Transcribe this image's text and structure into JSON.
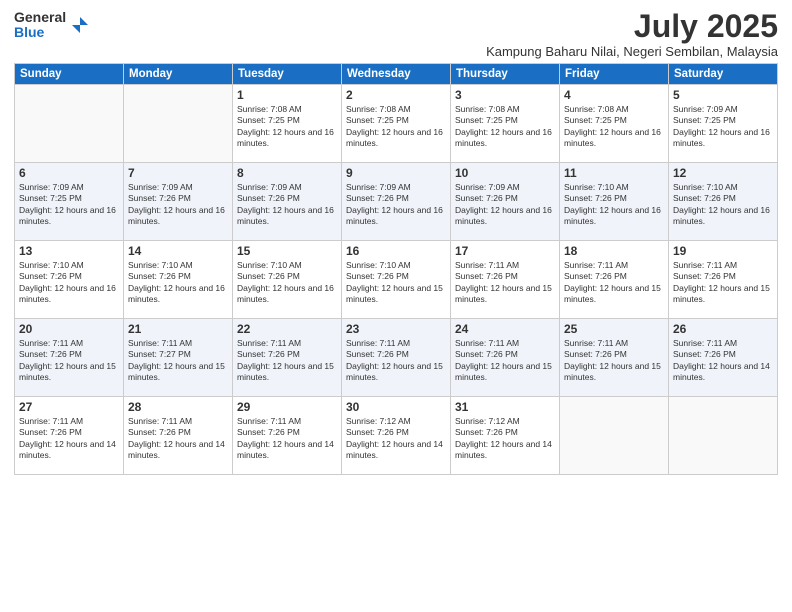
{
  "logo": {
    "general": "General",
    "blue": "Blue"
  },
  "title": "July 2025",
  "subtitle": "Kampung Baharu Nilai, Negeri Sembilan, Malaysia",
  "days_of_week": [
    "Sunday",
    "Monday",
    "Tuesday",
    "Wednesday",
    "Thursday",
    "Friday",
    "Saturday"
  ],
  "weeks": [
    [
      {
        "day": "",
        "sunrise": "",
        "sunset": "",
        "daylight": ""
      },
      {
        "day": "",
        "sunrise": "",
        "sunset": "",
        "daylight": ""
      },
      {
        "day": "1",
        "sunrise": "Sunrise: 7:08 AM",
        "sunset": "Sunset: 7:25 PM",
        "daylight": "Daylight: 12 hours and 16 minutes."
      },
      {
        "day": "2",
        "sunrise": "Sunrise: 7:08 AM",
        "sunset": "Sunset: 7:25 PM",
        "daylight": "Daylight: 12 hours and 16 minutes."
      },
      {
        "day": "3",
        "sunrise": "Sunrise: 7:08 AM",
        "sunset": "Sunset: 7:25 PM",
        "daylight": "Daylight: 12 hours and 16 minutes."
      },
      {
        "day": "4",
        "sunrise": "Sunrise: 7:08 AM",
        "sunset": "Sunset: 7:25 PM",
        "daylight": "Daylight: 12 hours and 16 minutes."
      },
      {
        "day": "5",
        "sunrise": "Sunrise: 7:09 AM",
        "sunset": "Sunset: 7:25 PM",
        "daylight": "Daylight: 12 hours and 16 minutes."
      }
    ],
    [
      {
        "day": "6",
        "sunrise": "Sunrise: 7:09 AM",
        "sunset": "Sunset: 7:25 PM",
        "daylight": "Daylight: 12 hours and 16 minutes."
      },
      {
        "day": "7",
        "sunrise": "Sunrise: 7:09 AM",
        "sunset": "Sunset: 7:26 PM",
        "daylight": "Daylight: 12 hours and 16 minutes."
      },
      {
        "day": "8",
        "sunrise": "Sunrise: 7:09 AM",
        "sunset": "Sunset: 7:26 PM",
        "daylight": "Daylight: 12 hours and 16 minutes."
      },
      {
        "day": "9",
        "sunrise": "Sunrise: 7:09 AM",
        "sunset": "Sunset: 7:26 PM",
        "daylight": "Daylight: 12 hours and 16 minutes."
      },
      {
        "day": "10",
        "sunrise": "Sunrise: 7:09 AM",
        "sunset": "Sunset: 7:26 PM",
        "daylight": "Daylight: 12 hours and 16 minutes."
      },
      {
        "day": "11",
        "sunrise": "Sunrise: 7:10 AM",
        "sunset": "Sunset: 7:26 PM",
        "daylight": "Daylight: 12 hours and 16 minutes."
      },
      {
        "day": "12",
        "sunrise": "Sunrise: 7:10 AM",
        "sunset": "Sunset: 7:26 PM",
        "daylight": "Daylight: 12 hours and 16 minutes."
      }
    ],
    [
      {
        "day": "13",
        "sunrise": "Sunrise: 7:10 AM",
        "sunset": "Sunset: 7:26 PM",
        "daylight": "Daylight: 12 hours and 16 minutes."
      },
      {
        "day": "14",
        "sunrise": "Sunrise: 7:10 AM",
        "sunset": "Sunset: 7:26 PM",
        "daylight": "Daylight: 12 hours and 16 minutes."
      },
      {
        "day": "15",
        "sunrise": "Sunrise: 7:10 AM",
        "sunset": "Sunset: 7:26 PM",
        "daylight": "Daylight: 12 hours and 16 minutes."
      },
      {
        "day": "16",
        "sunrise": "Sunrise: 7:10 AM",
        "sunset": "Sunset: 7:26 PM",
        "daylight": "Daylight: 12 hours and 15 minutes."
      },
      {
        "day": "17",
        "sunrise": "Sunrise: 7:11 AM",
        "sunset": "Sunset: 7:26 PM",
        "daylight": "Daylight: 12 hours and 15 minutes."
      },
      {
        "day": "18",
        "sunrise": "Sunrise: 7:11 AM",
        "sunset": "Sunset: 7:26 PM",
        "daylight": "Daylight: 12 hours and 15 minutes."
      },
      {
        "day": "19",
        "sunrise": "Sunrise: 7:11 AM",
        "sunset": "Sunset: 7:26 PM",
        "daylight": "Daylight: 12 hours and 15 minutes."
      }
    ],
    [
      {
        "day": "20",
        "sunrise": "Sunrise: 7:11 AM",
        "sunset": "Sunset: 7:26 PM",
        "daylight": "Daylight: 12 hours and 15 minutes."
      },
      {
        "day": "21",
        "sunrise": "Sunrise: 7:11 AM",
        "sunset": "Sunset: 7:27 PM",
        "daylight": "Daylight: 12 hours and 15 minutes."
      },
      {
        "day": "22",
        "sunrise": "Sunrise: 7:11 AM",
        "sunset": "Sunset: 7:26 PM",
        "daylight": "Daylight: 12 hours and 15 minutes."
      },
      {
        "day": "23",
        "sunrise": "Sunrise: 7:11 AM",
        "sunset": "Sunset: 7:26 PM",
        "daylight": "Daylight: 12 hours and 15 minutes."
      },
      {
        "day": "24",
        "sunrise": "Sunrise: 7:11 AM",
        "sunset": "Sunset: 7:26 PM",
        "daylight": "Daylight: 12 hours and 15 minutes."
      },
      {
        "day": "25",
        "sunrise": "Sunrise: 7:11 AM",
        "sunset": "Sunset: 7:26 PM",
        "daylight": "Daylight: 12 hours and 15 minutes."
      },
      {
        "day": "26",
        "sunrise": "Sunrise: 7:11 AM",
        "sunset": "Sunset: 7:26 PM",
        "daylight": "Daylight: 12 hours and 14 minutes."
      }
    ],
    [
      {
        "day": "27",
        "sunrise": "Sunrise: 7:11 AM",
        "sunset": "Sunset: 7:26 PM",
        "daylight": "Daylight: 12 hours and 14 minutes."
      },
      {
        "day": "28",
        "sunrise": "Sunrise: 7:11 AM",
        "sunset": "Sunset: 7:26 PM",
        "daylight": "Daylight: 12 hours and 14 minutes."
      },
      {
        "day": "29",
        "sunrise": "Sunrise: 7:11 AM",
        "sunset": "Sunset: 7:26 PM",
        "daylight": "Daylight: 12 hours and 14 minutes."
      },
      {
        "day": "30",
        "sunrise": "Sunrise: 7:12 AM",
        "sunset": "Sunset: 7:26 PM",
        "daylight": "Daylight: 12 hours and 14 minutes."
      },
      {
        "day": "31",
        "sunrise": "Sunrise: 7:12 AM",
        "sunset": "Sunset: 7:26 PM",
        "daylight": "Daylight: 12 hours and 14 minutes."
      },
      {
        "day": "",
        "sunrise": "",
        "sunset": "",
        "daylight": ""
      },
      {
        "day": "",
        "sunrise": "",
        "sunset": "",
        "daylight": ""
      }
    ]
  ]
}
